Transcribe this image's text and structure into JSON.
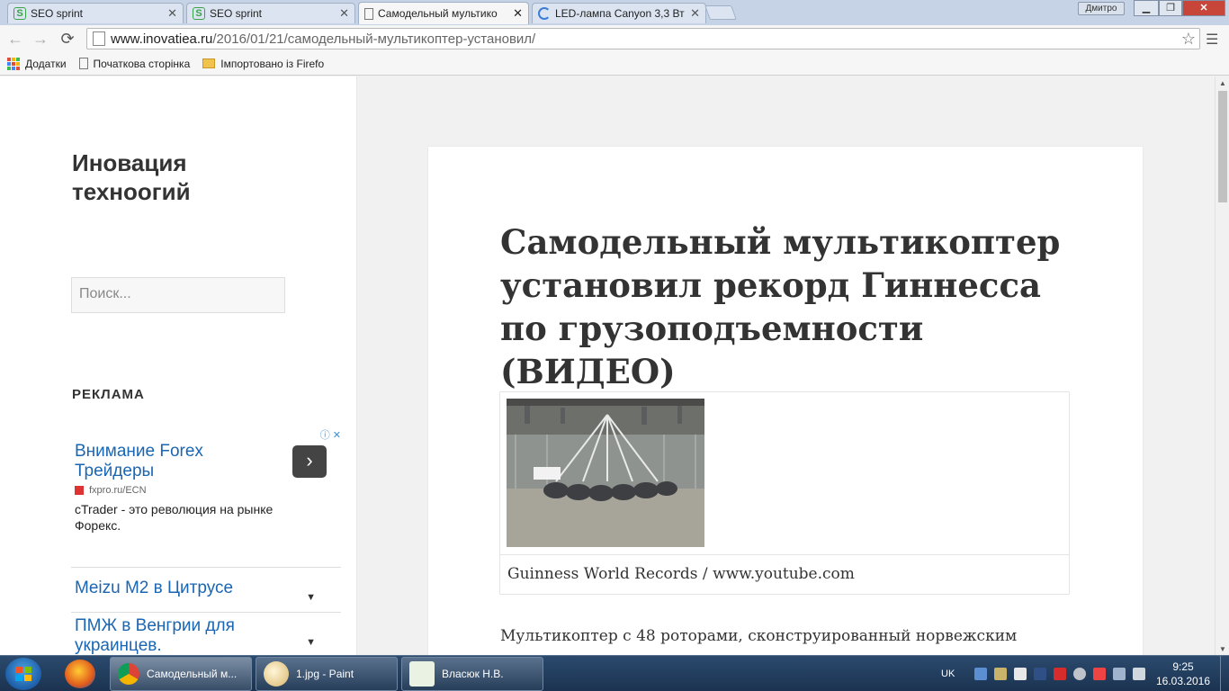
{
  "browser": {
    "tabs": [
      {
        "title": "SEO sprint",
        "icon": "seo-sprint-icon"
      },
      {
        "title": "SEO sprint",
        "icon": "seo-sprint-icon"
      },
      {
        "title": "Самодельный мультико",
        "icon": "page-icon",
        "active": true
      },
      {
        "title": "LED-лампа Canyon 3,3 Вт",
        "icon": "loading-icon"
      }
    ],
    "user_label": "Дмитро",
    "url_host": "www.inovatiea.ru",
    "url_path": "/2016/01/21/самодельный-мультикоптер-установил/",
    "bookmarks": [
      "Додатки",
      "Початкова сторінка",
      "Імпортовано із Firefo"
    ]
  },
  "sidebar": {
    "site_title": "Иновация техноогий",
    "search_placeholder": "Поиск...",
    "widget_title": "РЕКЛАМА",
    "ad": {
      "headline": "Внимание Forex Трейдеры",
      "url": "fxpro.ru/ECN",
      "text": "cTrader - это революция на рынке Форекс.",
      "choices_label": "ⓘ ✕"
    },
    "related": [
      {
        "label": "Meizu M2 в Цитрусе"
      },
      {
        "label": "ПМЖ в Венгрии для украинцев."
      }
    ]
  },
  "article": {
    "title": "Самодельный мультикоптер установил рекорд Гиннесса по грузоподъемности (ВИДЕО)",
    "caption": "Guinness World Records / www.youtube.com",
    "first_line": "Мультикоптер с 48 роторами, сконструированный норвежским"
  },
  "taskbar": {
    "tasks": [
      {
        "label": "Самодельный м...",
        "icon": "chrome-icon",
        "active": true
      },
      {
        "label": "1.jpg - Paint",
        "icon": "paint-icon"
      },
      {
        "label": "Власюк Н.В.",
        "icon": "notepad-icon"
      }
    ],
    "language": "UK",
    "time": "9:25",
    "date": "16.03.2016"
  },
  "colors": {
    "link": "#1a66b3",
    "text": "#333333",
    "page_bg": "#f1f1f1"
  }
}
